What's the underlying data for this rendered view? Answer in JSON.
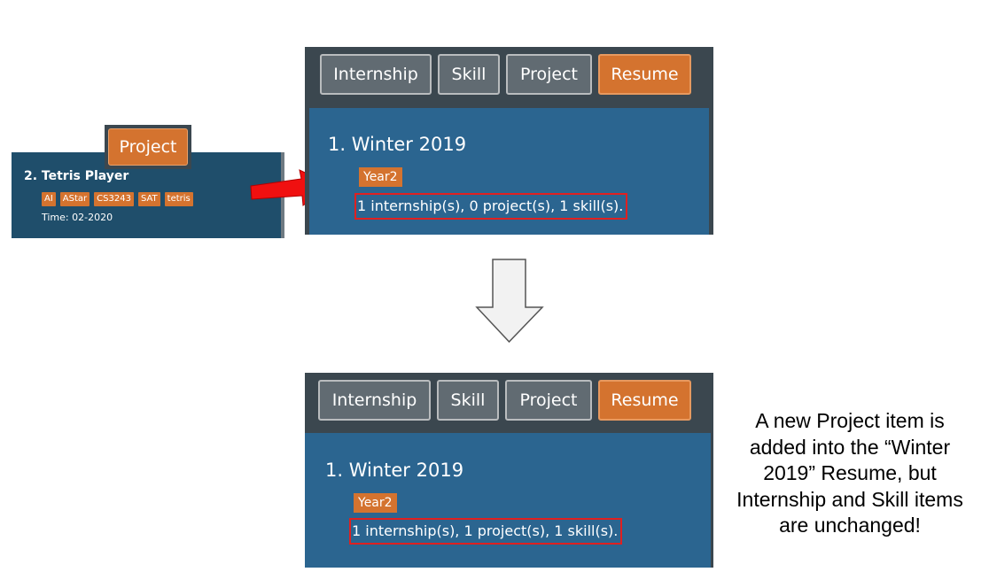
{
  "project_card": {
    "tab_label": "Project",
    "title": "2.  Tetris Player",
    "tags": [
      "AI",
      "AStar",
      "CS3243",
      "SAT",
      "tetris"
    ],
    "time": "Time: 02-2020"
  },
  "tabs": [
    "Internship",
    "Skill",
    "Project",
    "Resume"
  ],
  "active_tab": "Resume",
  "before": {
    "title": "1.  Winter 2019",
    "tag": "Year2",
    "summary": "1 internship(s), 0 project(s), 1 skill(s)."
  },
  "after": {
    "title": "1.  Winter 2019",
    "tag": "Year2",
    "summary": "1 internship(s), 1 project(s), 1 skill(s)."
  },
  "annotation": "A new Project item is added into the “Winter 2019” Resume, but Internship and Skill items are unchanged!",
  "colors": {
    "accent_orange": "#d4732f",
    "panel_dark": "#3b474f",
    "panel_blue": "#2b6590",
    "card_blue": "#1f4e6b",
    "highlight_red": "#e02020"
  }
}
